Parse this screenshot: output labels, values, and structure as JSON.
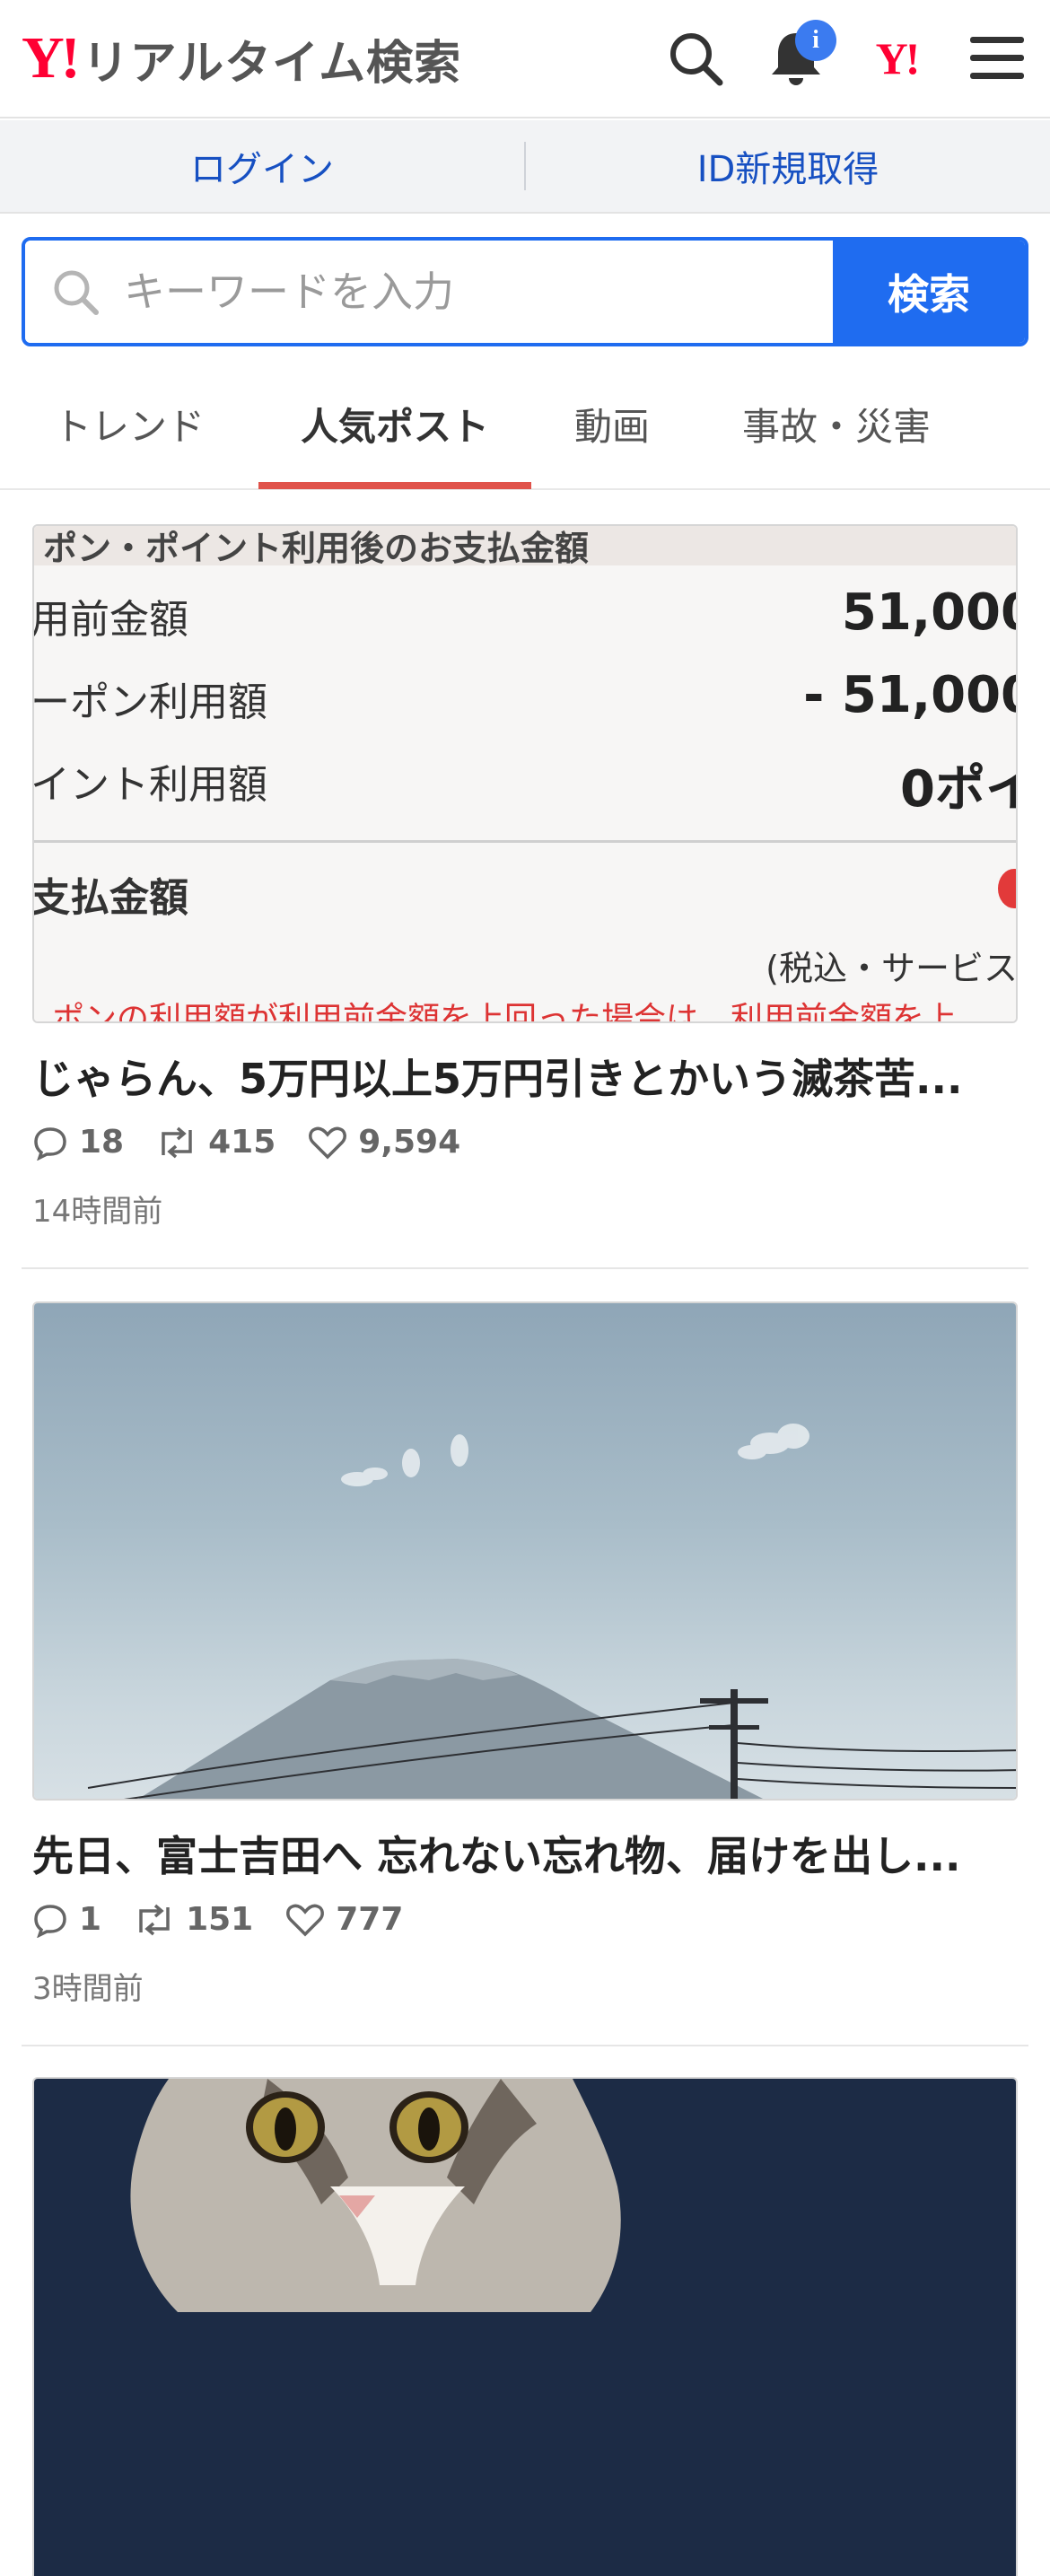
{
  "header": {
    "logo_mark": "Y!",
    "title": "リアルタイム検索",
    "notification_badge": "i",
    "yahoo_small": "Y!"
  },
  "login_bar": {
    "login": "ログイン",
    "register": "ID新規取得"
  },
  "search": {
    "placeholder": "キーワードを入力",
    "button": "検索"
  },
  "tabs": [
    {
      "label": "トレンド",
      "active": false
    },
    {
      "label": "人気ポスト",
      "active": true
    },
    {
      "label": "動画",
      "active": false
    },
    {
      "label": "事故・災害",
      "active": false
    }
  ],
  "posts": [
    {
      "title": "じゃらん、5万円以上5万円引きとかいう滅茶苦...",
      "replies": "18",
      "reposts": "415",
      "likes": "9,594",
      "time": "14時間前",
      "image": {
        "header": "ポン・ポイント利用後のお支払金額",
        "rows": [
          {
            "label": "用前金額",
            "value": "51,000"
          },
          {
            "label": "ーポン利用額",
            "value": "- 51,000"
          },
          {
            "label": "イント利用額",
            "value": "0ポイ"
          }
        ],
        "total_label": "支払金額",
        "tax_note": "(税込・サービス料",
        "footer_note": "ポンの利用額が利用前金額を上回った場合は、利用前金額を上"
      }
    },
    {
      "title": "先日、富士吉田へ 忘れない忘れ物、届けを出し...",
      "replies": "1",
      "reposts": "151",
      "likes": "777",
      "time": "3時間前"
    },
    {
      "title": "",
      "replies": "",
      "reposts": "",
      "likes": "",
      "time": ""
    }
  ],
  "colors": {
    "brand_red": "#ff0033",
    "accent_blue": "#1f6cf0",
    "link_blue": "#1750c2",
    "tab_underline": "#e0534b"
  },
  "icons": [
    "search-icon",
    "bell-icon",
    "menu-icon",
    "reply-icon",
    "repost-icon",
    "like-icon"
  ]
}
